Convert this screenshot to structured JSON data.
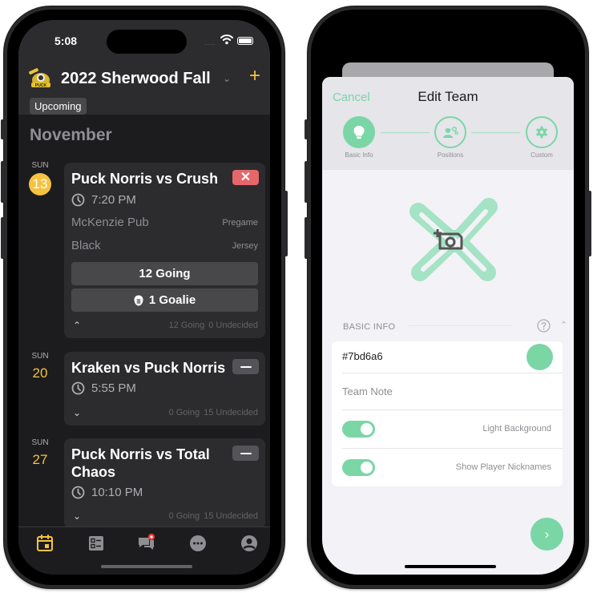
{
  "left_phone": {
    "status_bar": {
      "time": "5:08",
      "signal": "....",
      "wifi_icon": "wifi-icon",
      "battery_icon": "battery-icon"
    },
    "header": {
      "logo_icon": "team-logo",
      "season_title": "2022 Sherwood Fall",
      "season_dropdown_icon": "chevron-down-icon",
      "season_dropdown_glyph": "⌄",
      "add_glyph": "+",
      "filter_chip": "Upcoming"
    },
    "month": "November",
    "events": [
      {
        "day_of_week": "SUN",
        "day": "13",
        "is_today": true,
        "title": "Puck Norris vs Crush",
        "rsvp_status": "not-going",
        "rsvp_glyph": "✕",
        "time": "7:20 PM",
        "details": [
          {
            "value": "McKenzie Pub",
            "label": "Pregame"
          },
          {
            "value": "Black",
            "label": "Jersey"
          }
        ],
        "going_button": "12 Going",
        "goalie_button": "1 Goalie",
        "expanded": true,
        "toggle_glyph": "⌃",
        "going_count": "12 Going",
        "undecided_count": "0 Undecided"
      },
      {
        "day_of_week": "SUN",
        "day": "20",
        "is_today": false,
        "title": "Kraken vs Puck Norris",
        "rsvp_status": "undecided",
        "time": "5:55 PM",
        "expanded": false,
        "toggle_glyph": "⌄",
        "going_count": "0 Going",
        "undecided_count": "15 Undecided"
      },
      {
        "day_of_week": "SUN",
        "day": "27",
        "is_today": false,
        "title": "Puck Norris vs Total Chaos",
        "rsvp_status": "undecided",
        "time": "10:10 PM",
        "expanded": false,
        "toggle_glyph": "⌄",
        "going_count": "0 Going",
        "undecided_count": "15 Undecided"
      }
    ],
    "tab_bar": {
      "tabs": [
        {
          "name": "schedule",
          "icon": "calendar-icon",
          "active": true
        },
        {
          "name": "roster",
          "icon": "checklist-icon",
          "active": false
        },
        {
          "name": "chat",
          "icon": "chat-icon",
          "active": false,
          "badge": true
        },
        {
          "name": "more",
          "icon": "more-icon",
          "active": false
        },
        {
          "name": "profile",
          "icon": "profile-icon",
          "active": false
        }
      ]
    },
    "colors": {
      "accent": "#f5c242",
      "declined": "#e5676a",
      "background": "#1c1c1e",
      "card": "#2c2c2e"
    }
  },
  "right_phone": {
    "nav": {
      "cancel_label": "Cancel",
      "title": "Edit Team"
    },
    "steps": [
      {
        "label": "Basic Info",
        "icon": "lightbulb-icon",
        "active": true
      },
      {
        "label": "Positions",
        "icon": "positions-icon",
        "active": false
      },
      {
        "label": "Custom",
        "icon": "gear-icon",
        "active": false
      }
    ],
    "team_graphic": {
      "icon": "team-x-logo",
      "overlay_icon": "add-photo-icon"
    },
    "section": {
      "title": "BASIC INFO",
      "help_icon": "help-icon",
      "collapse_glyph": "⌃"
    },
    "form": {
      "color_value": "#7bd6a6",
      "team_note_placeholder": "Team Note",
      "toggles": [
        {
          "label": "Light Background",
          "on": true
        },
        {
          "label": "Show Player Nicknames",
          "on": true
        }
      ]
    },
    "next_glyph": "›",
    "colors": {
      "accent": "#7bd6a6",
      "background": "#f2f2f7"
    }
  }
}
